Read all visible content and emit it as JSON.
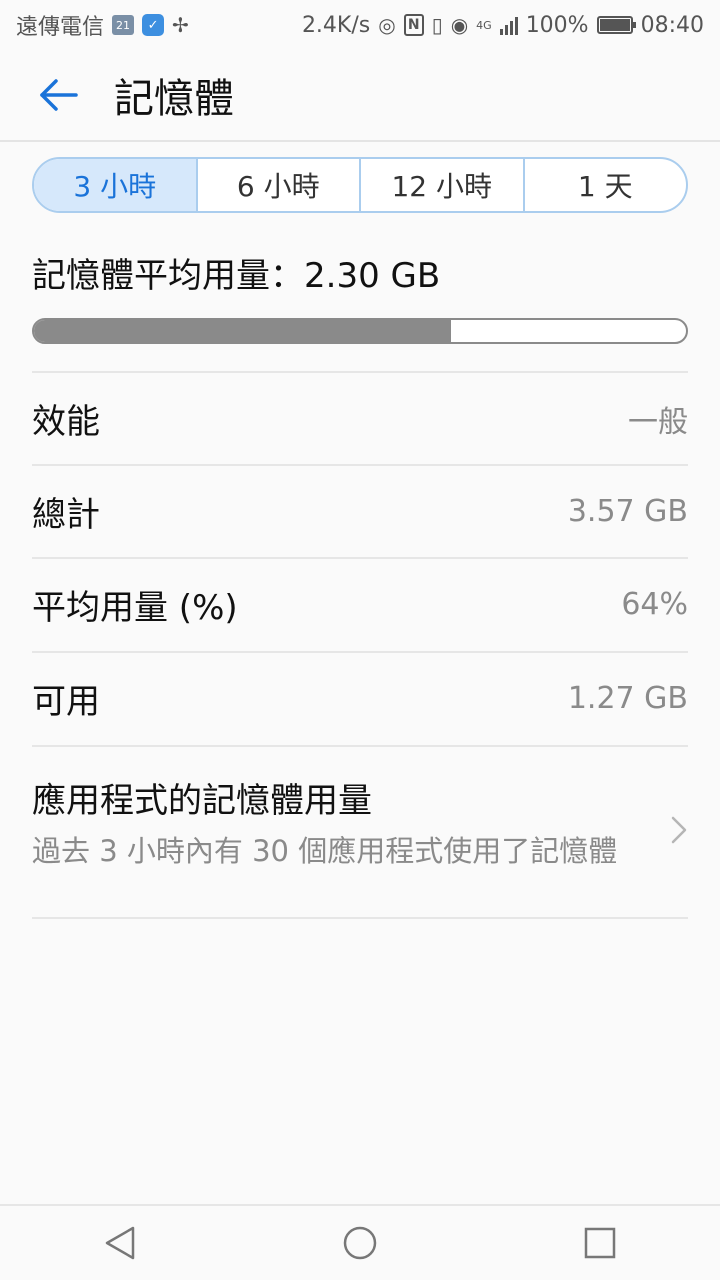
{
  "status_bar": {
    "carrier": "遠傳電信",
    "badge_number": "21",
    "net_speed": "2.4K/s",
    "network_type": "4G",
    "battery": "100%",
    "time": "08:40",
    "icons": [
      "calendar-icon",
      "shield-icon",
      "pinwheel-icon",
      "hotspot-icon",
      "nfc-icon",
      "vibrate-icon",
      "eye-icon",
      "signal-icon",
      "battery-icon"
    ]
  },
  "header": {
    "title": "記憶體",
    "back_icon": "arrow-left-icon"
  },
  "tabs": [
    {
      "label": "3 小時",
      "active": true
    },
    {
      "label": "6 小時",
      "active": false
    },
    {
      "label": "12 小時",
      "active": false
    },
    {
      "label": "1 天",
      "active": false
    }
  ],
  "average": {
    "label": "記憶體平均用量：2.30 GB",
    "fill_fraction": 0.64
  },
  "rows": [
    {
      "label": "效能",
      "value": "一般"
    },
    {
      "label": "總計",
      "value": "3.57 GB"
    },
    {
      "label": "平均用量 (%)",
      "value": "64%"
    },
    {
      "label": "可用",
      "value": "1.27 GB"
    }
  ],
  "app_usage": {
    "title": "應用程式的記憶體用量",
    "subtitle": "過去 3 小時內有 30 個應用程式使用了記憶體"
  },
  "colors": {
    "accent": "#1a73d9",
    "tab_active_bg": "#d6e8fb",
    "progress_fill": "#8a8a8a"
  }
}
